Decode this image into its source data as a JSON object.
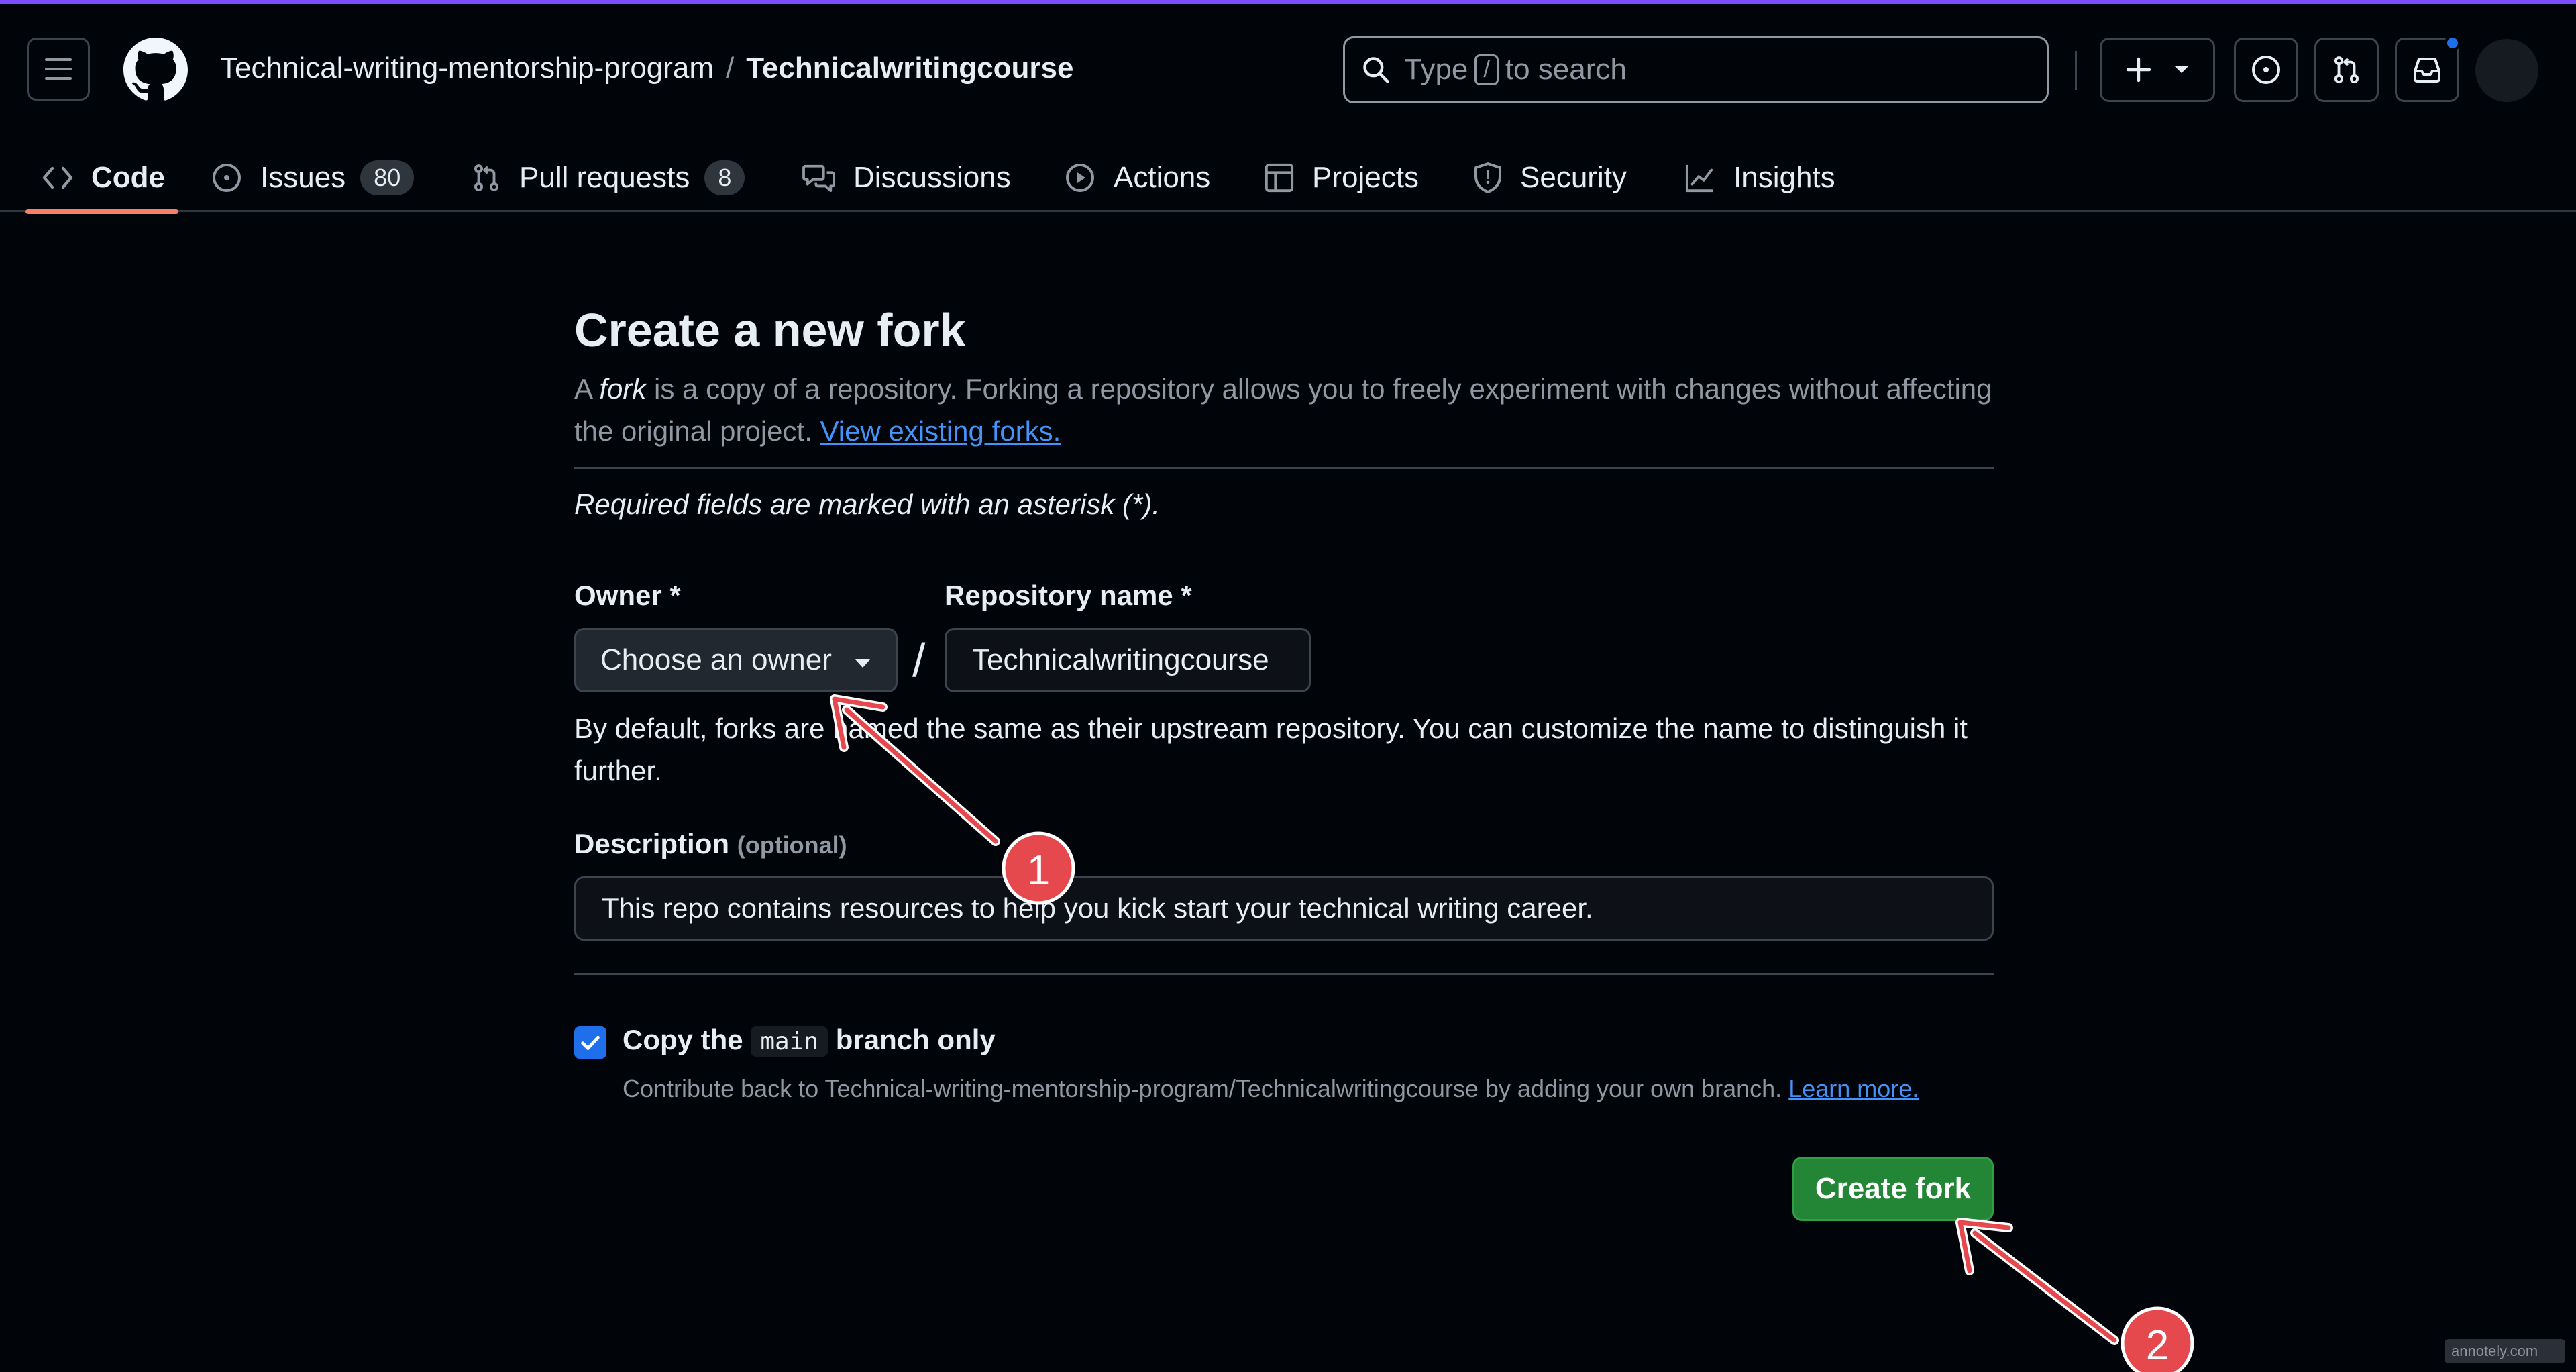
{
  "header": {
    "org": "Technical-writing-mentorship-program",
    "separator": "/",
    "repo": "Technicalwritingcourse",
    "search_prefix": "Type",
    "search_key": "/",
    "search_suffix": "to search"
  },
  "tabs": [
    {
      "label": "Code",
      "icon": "code-icon",
      "active": true
    },
    {
      "label": "Issues",
      "icon": "issue-opened-icon",
      "count": "80"
    },
    {
      "label": "Pull requests",
      "icon": "git-pull-request-icon",
      "count": "8"
    },
    {
      "label": "Discussions",
      "icon": "comment-discussion-icon"
    },
    {
      "label": "Actions",
      "icon": "play-icon"
    },
    {
      "label": "Projects",
      "icon": "table-icon"
    },
    {
      "label": "Security",
      "icon": "shield-icon"
    },
    {
      "label": "Insights",
      "icon": "graph-icon"
    }
  ],
  "form": {
    "title": "Create a new fork",
    "lead_1": "A ",
    "lead_em": "fork",
    "lead_2": " is a copy of a repository. Forking a repository allows you to freely experiment with changes without affecting the original project. ",
    "lead_link": "View existing forks.",
    "required_note": "Required fields are marked with an asterisk (*).",
    "owner_label": "Owner *",
    "owner_value": "Choose an owner",
    "slash": "/",
    "repo_label": "Repository name *",
    "repo_value": "Technicalwritingcourse",
    "name_hint": "By default, forks are named the same as their upstream repository. You can customize the name to distinguish it further.",
    "desc_label": "Description",
    "desc_optional": "(optional)",
    "desc_value": "This repo contains resources to help you kick start your technical writing career.",
    "copy_prefix": "Copy the",
    "copy_branch": "main",
    "copy_suffix": "branch only",
    "copy_checked": true,
    "copy_help": "Contribute back to Technical-writing-mentorship-program/Technicalwritingcourse by adding your own branch. ",
    "copy_help_link": "Learn more.",
    "submit_label": "Create fork"
  },
  "annotations": [
    {
      "number": "1"
    },
    {
      "number": "2"
    }
  ],
  "watermark": "annotely.com",
  "colors": {
    "background": "#010409",
    "accent_link": "#4493f8",
    "primary_button": "#238636",
    "annotation_red": "#e5484d",
    "tab_underline": "#f78166"
  }
}
